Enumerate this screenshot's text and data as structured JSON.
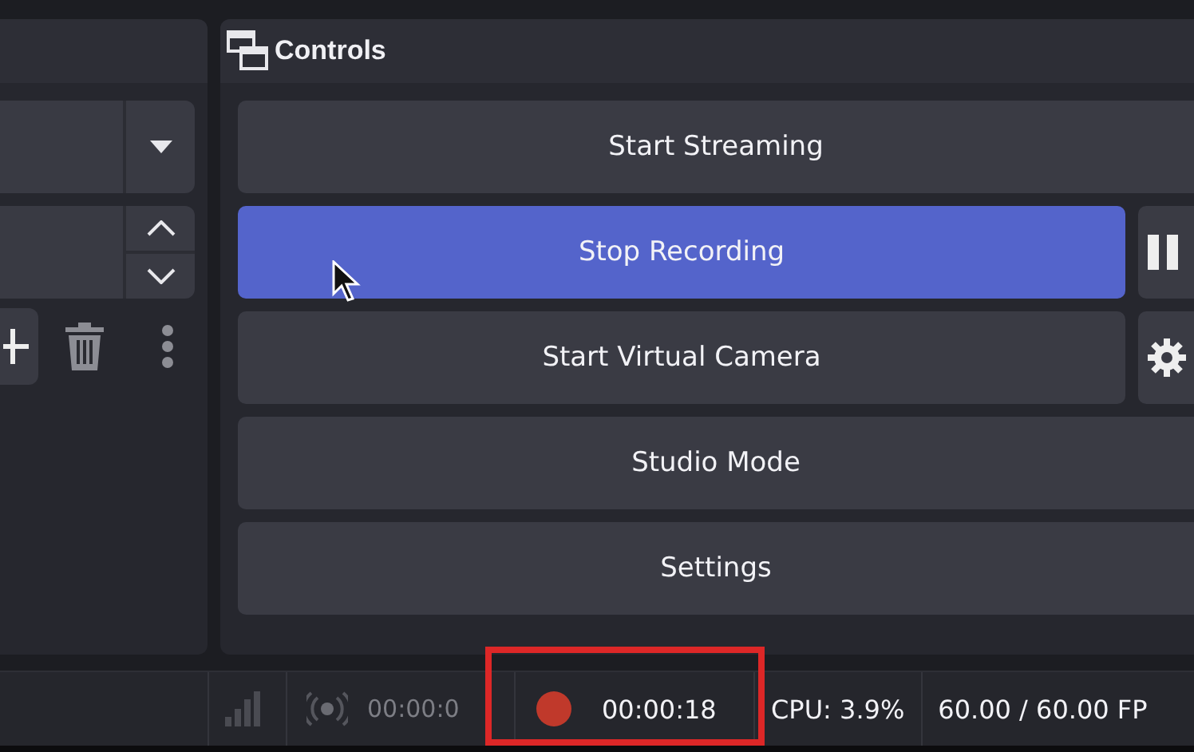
{
  "left_dock": {
    "toolbar": [
      {
        "kind": "add"
      },
      {
        "kind": "remove"
      },
      {
        "kind": "more"
      }
    ]
  },
  "controls": {
    "title": "Controls",
    "buttons": [
      {
        "label": "Start Streaming",
        "kind": "wide",
        "selected": false
      },
      {
        "label": "Stop Recording",
        "kind": "with-side",
        "selected": true,
        "side_button": {
          "kind": "pause"
        }
      },
      {
        "label": "Start Virtual Camera",
        "kind": "with-side",
        "selected": false,
        "side_button": {
          "kind": "gear"
        }
      },
      {
        "label": "Studio Mode",
        "kind": "wide",
        "selected": false
      },
      {
        "label": "Settings",
        "kind": "wide",
        "selected": false
      }
    ]
  },
  "status_bar": {
    "stream": {
      "time": "00:00:0",
      "active": false
    },
    "recording": {
      "time": "00:00:18",
      "active": true,
      "highlighted": true
    },
    "cpu": "CPU: 3.9%",
    "fps": "60.00 / 60.00 FP"
  }
}
